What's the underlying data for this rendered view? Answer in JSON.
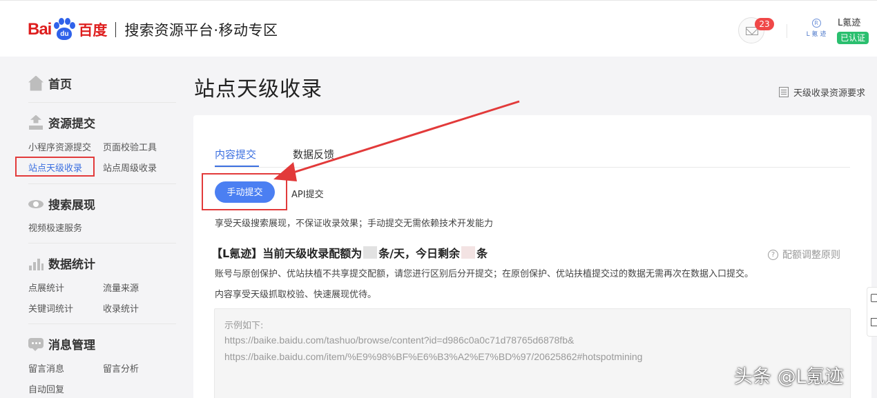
{
  "header": {
    "logo_bai": "Bai",
    "logo_du": "du",
    "logo_cn": "百度",
    "platform_title": "搜索资源平台·移动专区",
    "mail_badge": "23",
    "avatar_text": "L 氪 迹",
    "avatar_mark": "R",
    "user_name": "L氪迹",
    "verified_label": "已认证"
  },
  "sidebar": {
    "home": "首页",
    "sections": [
      {
        "title": "资源提交",
        "links": [
          "小程序资源提交",
          "页面校验工具",
          "站点天级收录",
          "站点周级收录"
        ]
      },
      {
        "title": "搜索展现",
        "links": [
          "视频极速服务"
        ]
      },
      {
        "title": "数据统计",
        "links": [
          "点展统计",
          "流量来源",
          "关键词统计",
          "收录统计"
        ]
      },
      {
        "title": "消息管理",
        "links": [
          "留言消息",
          "留言分析",
          "自动回复"
        ]
      }
    ],
    "active_link": "站点天级收录"
  },
  "main": {
    "page_title": "站点天级收录",
    "requirements_link": "天级收录资源要求",
    "tabs": [
      {
        "label": "内容提交",
        "active": true
      },
      {
        "label": "数据反馈",
        "active": false
      }
    ],
    "submit_modes": {
      "manual": "手动提交",
      "api": "API提交"
    },
    "desc_manual": "享受天级搜索展现，不保证收录效果；手动提交无需依赖技术开发能力",
    "quota_prefix": "【L氪迹】当前天级收录配额为",
    "quota_middle": "条/天，今日剩余",
    "quota_suffix": "条",
    "adjust_link": "配额调整原则",
    "note_1": "账号与原创保护、优站扶植不共享提交配额，请您进行区别后分开提交；在原创保护、优站扶植提交过的数据无需再次在数据入口提交。",
    "note_2": "内容享受天级抓取校验、快速展现优待。",
    "example_label": "示例如下:",
    "example_urls": [
      "https://baike.baidu.com/tashuo/browse/content?id=d986c0a0c71d78765d6878fb&",
      "https://baike.baidu.com/item/%E9%98%BF%E6%B3%A2%E7%BD%97/20625862#hotspotmining"
    ]
  },
  "watermark": "头条 @L氪迹",
  "colors": {
    "brand_red": "#de1e1e",
    "brand_blue": "#2f62ea",
    "accent": "#3b6fe0",
    "annotation_red": "#e23a3a",
    "verified_green": "#2bbf6f"
  },
  "icons": [
    "home-icon",
    "upload-icon",
    "eye-icon",
    "bar-chart-icon",
    "message-icon",
    "mail-icon",
    "document-icon",
    "question-icon"
  ]
}
